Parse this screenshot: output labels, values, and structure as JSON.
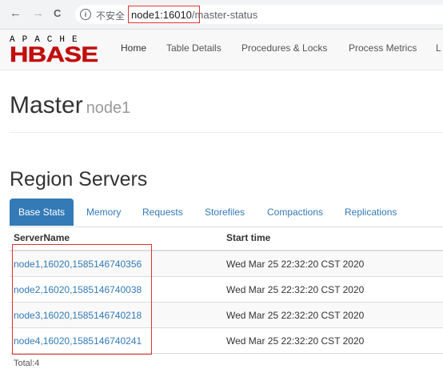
{
  "browser": {
    "back_icon": "←",
    "forward_icon": "→",
    "reload_icon": "C",
    "info_icon": "i",
    "insecure_label": "不安全",
    "url_host": "node1:16010",
    "url_path": "/master-status"
  },
  "logo": {
    "top": "APACHE",
    "main": "HBASE"
  },
  "nav": {
    "items": [
      "Home",
      "Table Details",
      "Procedures & Locks",
      "Process Metrics",
      "L"
    ]
  },
  "header": {
    "title": "Master",
    "subtitle": "node1"
  },
  "region_servers": {
    "title": "Region Servers",
    "tabs": [
      "Base Stats",
      "Memory",
      "Requests",
      "Storefiles",
      "Compactions",
      "Replications"
    ],
    "active_tab": "Base Stats",
    "columns": [
      "ServerName",
      "Start time"
    ],
    "rows": [
      {
        "server": "node1,16020,1585146740356",
        "start": "Wed Mar 25 22:32:20 CST 2020"
      },
      {
        "server": "node2,16020,1585146740038",
        "start": "Wed Mar 25 22:32:20 CST 2020"
      },
      {
        "server": "node3,16020,1585146740218",
        "start": "Wed Mar 25 22:32:20 CST 2020"
      },
      {
        "server": "node4,16020,1585146740241",
        "start": "Wed Mar 25 22:32:20 CST 2020"
      }
    ],
    "total": "Total:4"
  },
  "colors": {
    "accent": "#337ab7",
    "logo_red": "#c20e0e",
    "annotation": "#e03030"
  }
}
